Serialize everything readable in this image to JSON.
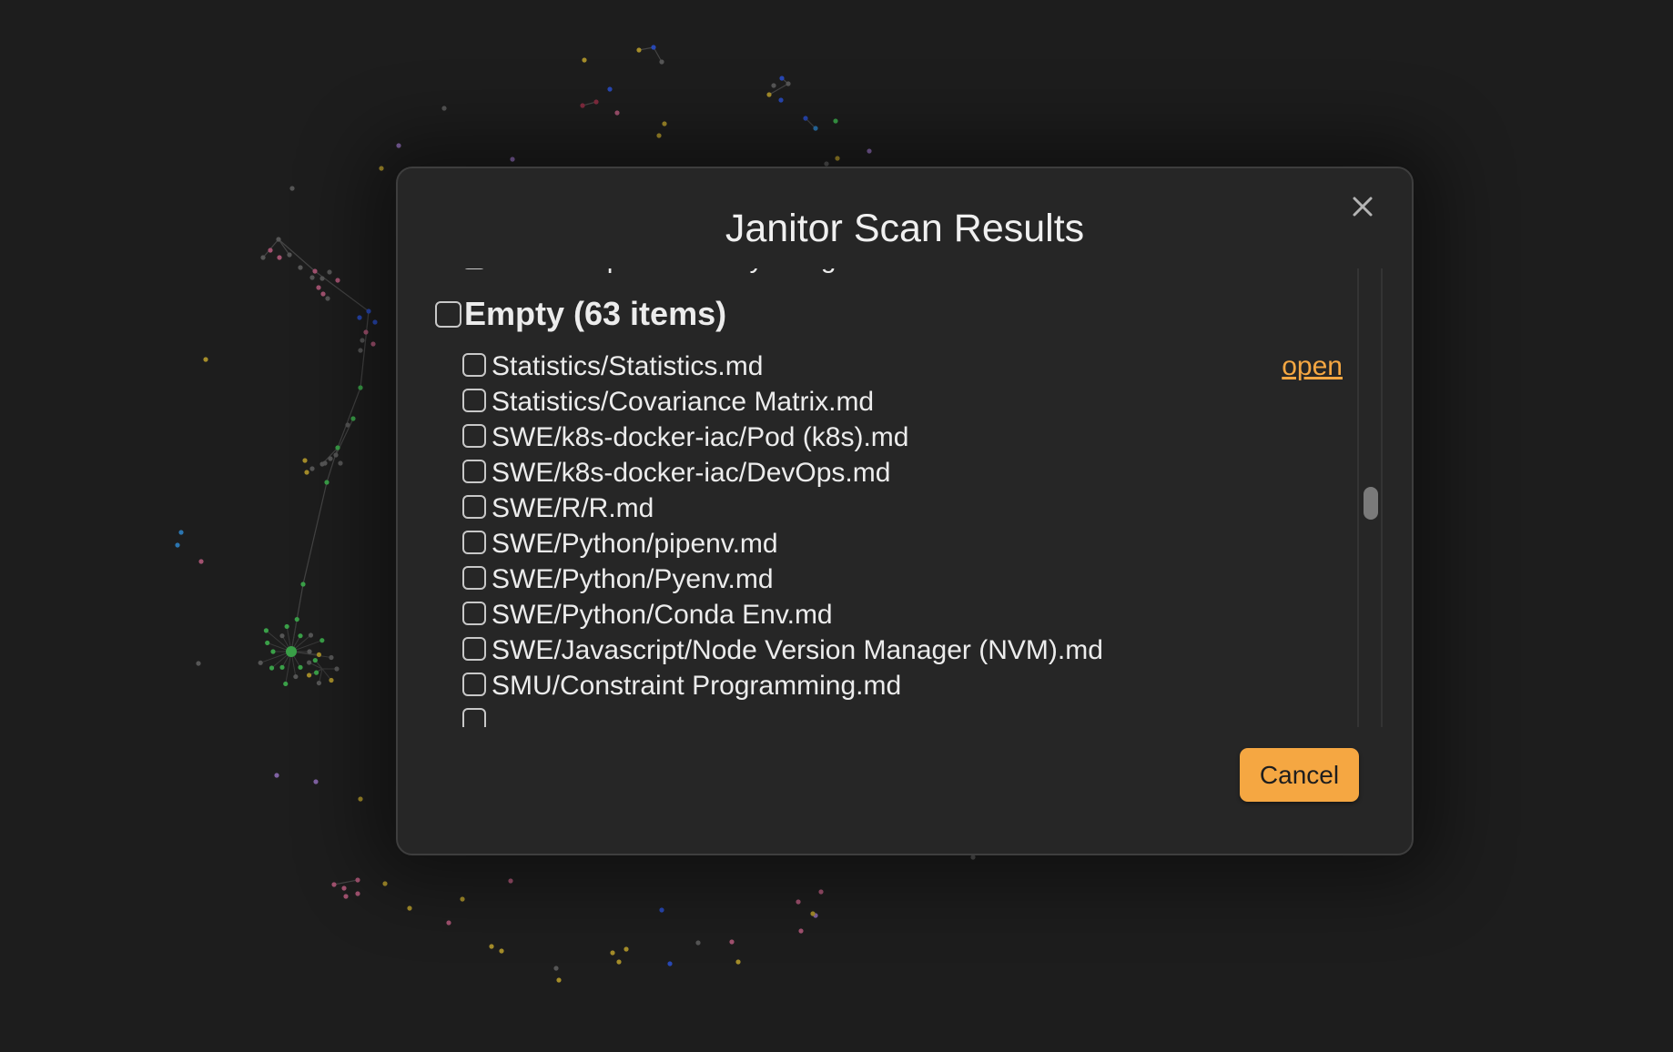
{
  "modal": {
    "title": "Janitor Scan Results",
    "close_icon": "close-icon",
    "partial_top_item": "Context/spacesLastSync.log",
    "group": {
      "label": "Empty (63 items)"
    },
    "open_link": "open",
    "files": [
      "Statistics/Statistics.md",
      "Statistics/Covariance Matrix.md",
      "SWE/k8s-docker-iac/Pod (k8s).md",
      "SWE/k8s-docker-iac/DevOps.md",
      "SWE/R/R.md",
      "SWE/Python/pipenv.md",
      "SWE/Python/Pyenv.md",
      "SWE/Python/Conda Env.md",
      "SWE/Javascript/Node Version Manager (NVM).md",
      "SMU/Constraint Programming.md"
    ],
    "cancel_label": "Cancel"
  },
  "colors": {
    "background": "#202020",
    "modal_bg": "#262626",
    "accent": "#f5a742",
    "text": "#ececec"
  }
}
